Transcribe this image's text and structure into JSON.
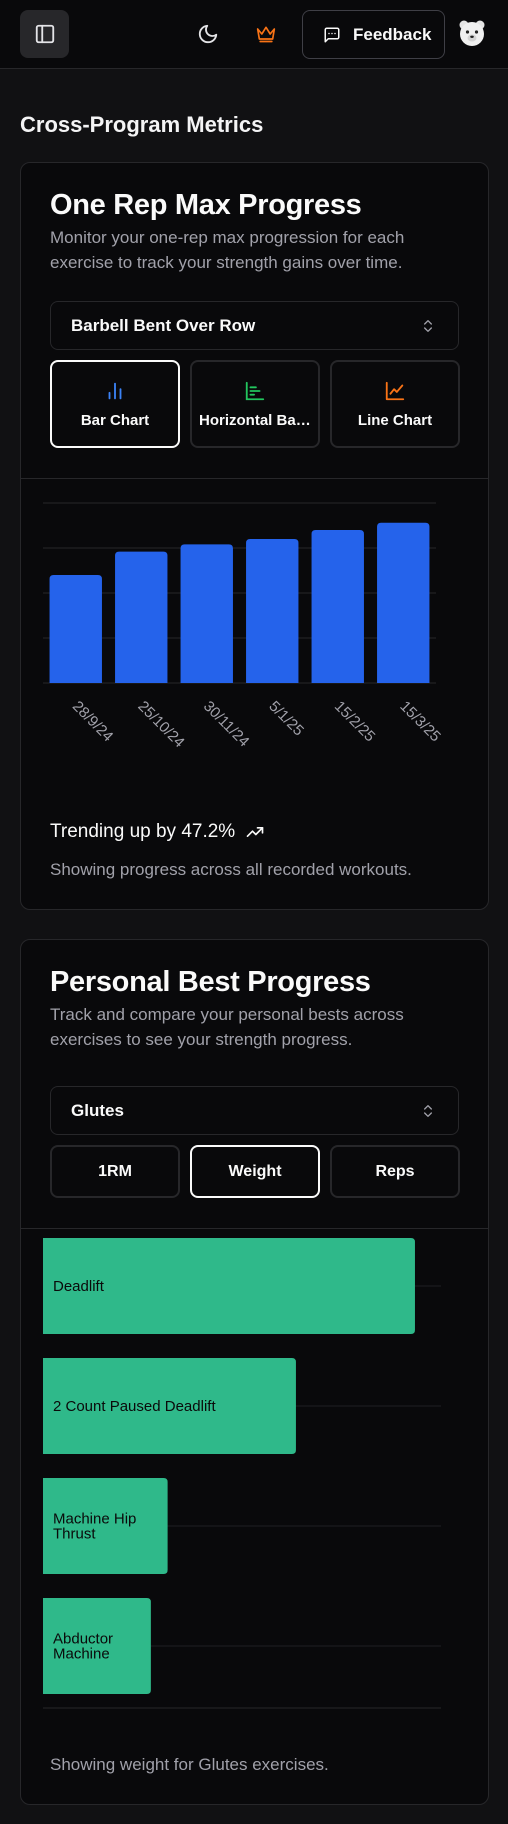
{
  "header": {
    "feedback_label": "Feedback",
    "icons": [
      "sidebar-toggle-icon",
      "moon-icon",
      "crown-icon",
      "message-icon",
      "avatar"
    ]
  },
  "page": {
    "section_title": "Cross-Program Metrics"
  },
  "one_rep_max": {
    "title": "One Rep Max Progress",
    "description": "Monitor your one-rep max progression for each exercise to track your strength gains over time.",
    "selected_exercise": "Barbell Bent Over Row",
    "chart_types": [
      {
        "label": "Bar Chart",
        "icon": "bar-chart-icon",
        "color": "#3b82f6",
        "active": true
      },
      {
        "label": "Horizontal Bar Chart",
        "icon": "horizontal-bar-chart-icon",
        "color": "#22c55e",
        "active": false
      },
      {
        "label": "Line Chart",
        "icon": "line-chart-icon",
        "color": "#f97316",
        "active": false
      }
    ],
    "trend_text": "Trending up by 47.2%",
    "footer": "Showing progress across all recorded workouts."
  },
  "personal_best": {
    "title": "Personal Best Progress",
    "description": "Track and compare your personal bests across exercises to see your strength progress.",
    "selected_muscle": "Glutes",
    "metrics": [
      {
        "label": "1RM",
        "active": false
      },
      {
        "label": "Weight",
        "active": true
      },
      {
        "label": "Reps",
        "active": false
      }
    ],
    "footer": "Showing weight for Glutes exercises."
  },
  "chart_data": [
    {
      "type": "bar",
      "categories": [
        "28/9/24",
        "25/10/24",
        "30/11/24",
        "5/1/25",
        "15/2/25",
        "15/3/25"
      ],
      "values": [
        60,
        73,
        77,
        80,
        85,
        89
      ],
      "ylim": [
        0,
        100
      ],
      "grid": true,
      "color": "#2563eb"
    },
    {
      "type": "bar",
      "orientation": "horizontal",
      "categories": [
        "Deadlift",
        "2 Count Paused Deadlift",
        "Machine Hip Thrust",
        "Abductor Machine"
      ],
      "values": [
        100,
        68,
        33.5,
        29
      ],
      "xlim": [
        0,
        107
      ],
      "grid": true,
      "color": "#2fb98a"
    }
  ]
}
